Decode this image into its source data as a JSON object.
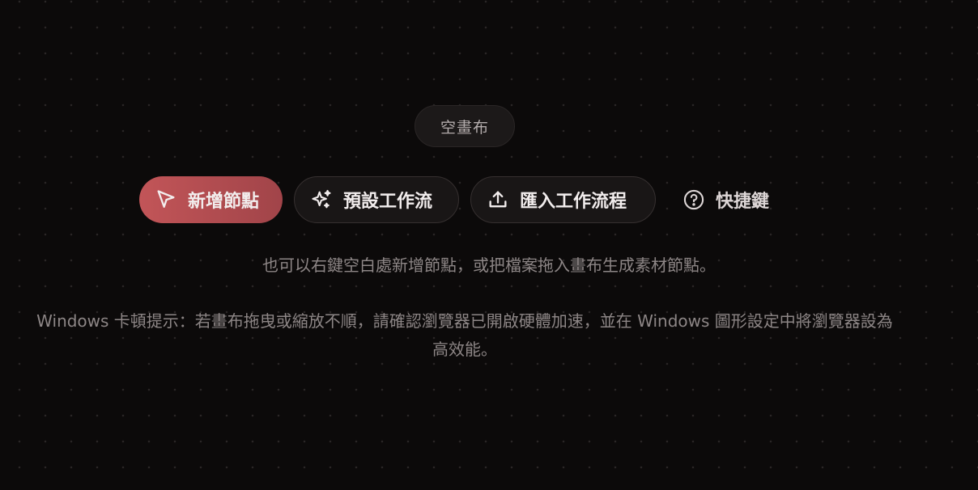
{
  "canvas": {
    "status_badge": "空畫布"
  },
  "toolbar": {
    "add_node_label": "新增節點",
    "preset_workflow_label": "預設工作流",
    "import_workflow_label": "匯入工作流程",
    "shortcuts_label": "快捷鍵"
  },
  "hints": {
    "line1": "也可以右鍵空白處新增節點，或把檔案拖入畫布生成素材節點。",
    "line2": "Windows 卡頓提示：若畫布拖曳或縮放不順，請確認瀏覽器已開啟硬體加速，並在 Windows 圖形設定中將瀏覽器設為高效能。"
  },
  "icons": {
    "add_node": "cursor-arrow-icon",
    "preset_workflow": "sparkles-icon",
    "import_workflow": "upload-icon",
    "shortcuts": "question-circle-icon"
  },
  "colors": {
    "background": "#0c0a0a",
    "primary_start": "#c25558",
    "primary_end": "#a14449",
    "text": "#f2eded",
    "muted": "#8d8686"
  }
}
